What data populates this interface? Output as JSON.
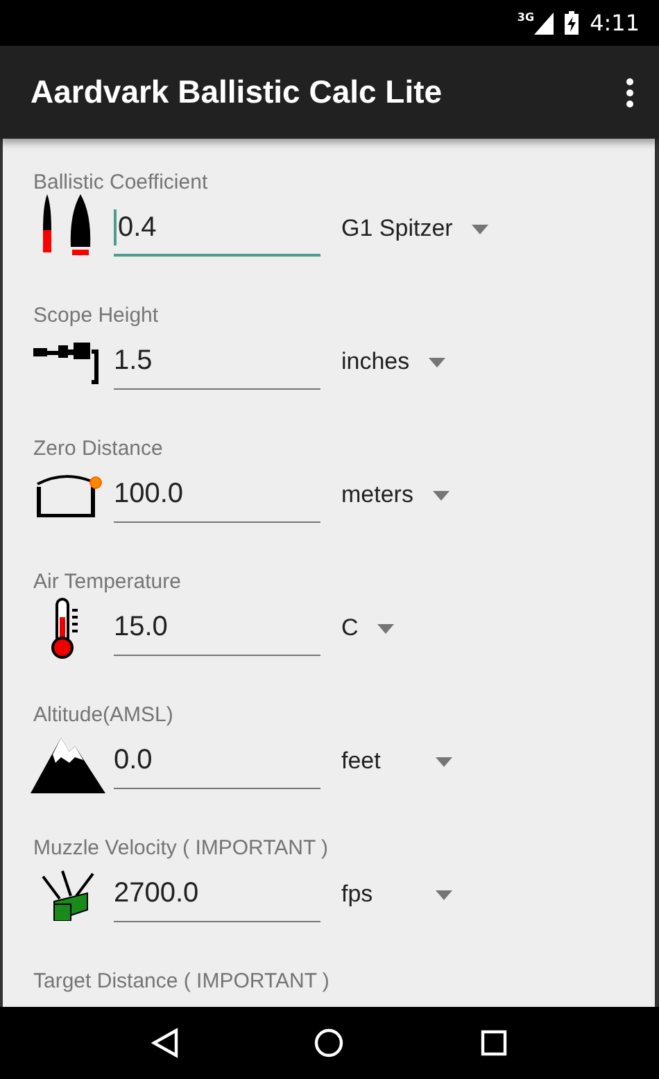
{
  "status_bar": {
    "network": "3G",
    "time": "4:11"
  },
  "toolbar": {
    "title": "Aardvark Ballistic Calc Lite"
  },
  "fields": [
    {
      "label": "Ballistic Coefficient",
      "value": "0.4",
      "focused": true,
      "unit": "G1 Spitzer"
    },
    {
      "label": "Scope Height",
      "value": "1.5",
      "focused": false,
      "unit": "inches"
    },
    {
      "label": "Zero Distance",
      "value": "100.0",
      "focused": false,
      "unit": "meters"
    },
    {
      "label": "Air Temperature",
      "value": "15.0",
      "focused": false,
      "unit": "C"
    },
    {
      "label": "Altitude(AMSL)",
      "value": "0.0",
      "focused": false,
      "unit": "feet"
    },
    {
      "label": "Muzzle Velocity ( IMPORTANT )",
      "value": "2700.0",
      "focused": false,
      "unit": "fps"
    },
    {
      "label": "Target Distance ( IMPORTANT )"
    }
  ]
}
